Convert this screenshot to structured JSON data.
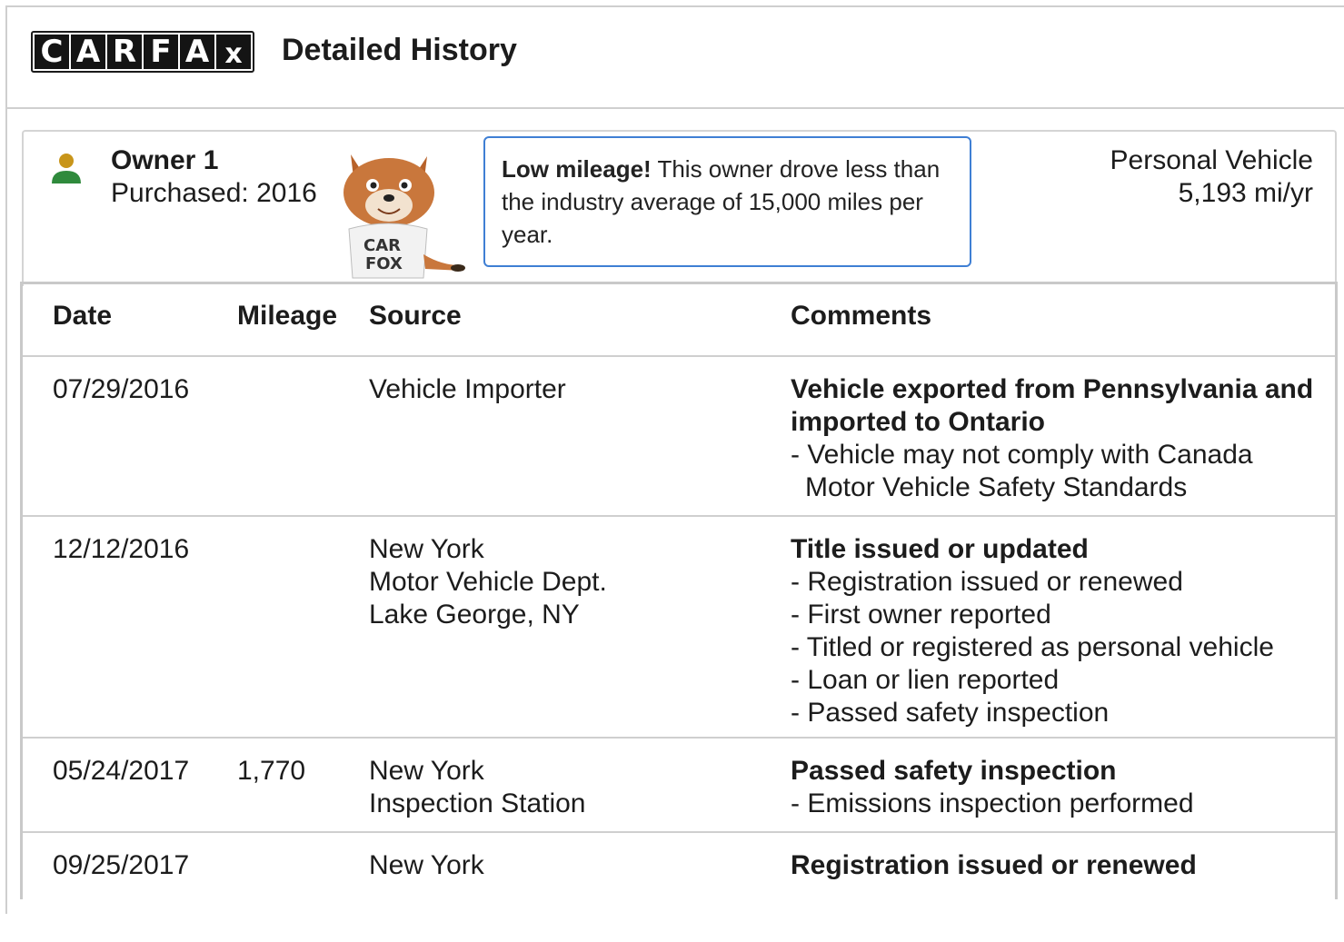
{
  "header": {
    "logo_letters": [
      "C",
      "A",
      "R",
      "F",
      "A",
      "x"
    ],
    "title": "Detailed History"
  },
  "owner": {
    "name": "Owner 1",
    "purchased": "Purchased: 2016",
    "callout_bold": "Low mileage!",
    "callout_text": " This owner drove less than the industry average of 15,000 miles per year.",
    "vehicle_type": "Personal Vehicle",
    "miles_per_year": "5,193 mi/yr"
  },
  "table": {
    "headers": {
      "date": "Date",
      "mileage": "Mileage",
      "source": "Source",
      "comments": "Comments"
    },
    "rows": [
      {
        "date": "07/29/2016",
        "mileage": "",
        "source": [
          "Vehicle Importer"
        ],
        "comment_head": "Vehicle exported from Pennsylvania and imported to Ontario",
        "comment_items": [
          "- Vehicle may not comply with Canada Motor Vehicle Safety Standards"
        ]
      },
      {
        "date": "12/12/2016",
        "mileage": "",
        "source": [
          "New York",
          "Motor Vehicle Dept.",
          "Lake George, NY"
        ],
        "comment_head": "Title issued or updated",
        "comment_items": [
          "- Registration issued or renewed",
          "- First owner reported",
          "- Titled or registered as personal vehicle",
          "- Loan or lien reported",
          "- Passed safety inspection"
        ]
      },
      {
        "date": "05/24/2017",
        "mileage": "1,770",
        "source": [
          "New York",
          "Inspection Station"
        ],
        "comment_head": "Passed safety inspection",
        "comment_items": [
          "- Emissions inspection performed"
        ]
      },
      {
        "date": "09/25/2017",
        "mileage": "",
        "source": [
          "New York"
        ],
        "comment_head": "Registration issued or renewed",
        "comment_items": []
      }
    ]
  },
  "colors": {
    "callout_border": "#3f7fd4",
    "person_head": "#c8951a",
    "person_body": "#2f8a3c"
  }
}
